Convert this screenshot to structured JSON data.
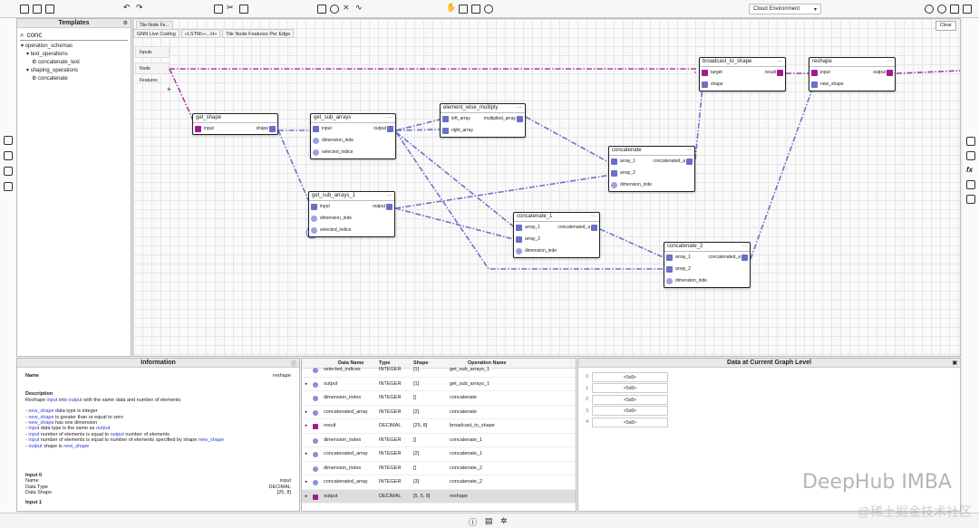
{
  "toolbar": {
    "environment": "Cloud Environment"
  },
  "templates": {
    "title": "Templates",
    "search_value": "conc",
    "tree": [
      {
        "label": "operation_schemas",
        "level": 0
      },
      {
        "label": "text_operations",
        "level": 1
      },
      {
        "label": "concatenate_text",
        "level": 2
      },
      {
        "label": "shaping_operations",
        "level": 1
      },
      {
        "label": "concatenate",
        "level": 2
      }
    ]
  },
  "canvas": {
    "tab_top": "Tile Node Fe...",
    "tabs": [
      "GNN Live Coding",
      "«LSTM»«...H»",
      "Tile Node Features Per Edge"
    ],
    "clear": "Clear",
    "ports": [
      "Inputs",
      "Node Features"
    ]
  },
  "nodes": {
    "get_shape": {
      "title": "get_shape",
      "in": "input",
      "out": "shape"
    },
    "get_sub_arrays": {
      "title": "get_sub_arrays",
      "rows": [
        "input",
        "dimension_inde",
        "selected_indice"
      ],
      "out": "output"
    },
    "element_wise_multiply": {
      "title": "element_wise_multiply",
      "rows": [
        "left_array",
        "right_array"
      ],
      "out": "multiplied_array"
    },
    "get_sub_arrays_1": {
      "title": "get_sub_arrays_1",
      "rows": [
        "input",
        "dimension_inde",
        "selected_indice"
      ],
      "out": "output"
    },
    "concatenate": {
      "title": "concatenate",
      "rows": [
        "array_1",
        "array_2",
        "dimension_inde"
      ],
      "out": "concatenated_a"
    },
    "concatenate_1": {
      "title": "concatenate_1",
      "rows": [
        "array_1",
        "array_2",
        "dimension_inde"
      ],
      "out": "concatenated_a"
    },
    "concatenate_2": {
      "title": "concatenate_2",
      "rows": [
        "array_1",
        "array_2",
        "dimension_inde"
      ],
      "out": "concatenated_a"
    },
    "broadcast_to_shape": {
      "title": "broadcast_to_shape",
      "rows": [
        "target",
        "shape"
      ],
      "out": "result"
    },
    "reshape": {
      "title": "reshape",
      "rows": [
        "input",
        "new_shape"
      ],
      "out": "output"
    }
  },
  "info": {
    "title": "Information",
    "name_label": "Name",
    "name_value": "reshape",
    "desc_label": "Description",
    "desc_pre": "Reshape ",
    "desc_in": "input",
    "desc_mid": " into ",
    "desc_out": "output",
    "desc_post": " with the same data and number of elements",
    "bullets": [
      {
        "a": "new_shape",
        "b": " data type is integer"
      },
      {
        "a": "new_shape",
        "b": " is greater than or equal to zero"
      },
      {
        "a": "new_shape",
        "b": " has one dimension"
      },
      {
        "a": "input",
        "b": " data type is the same as ",
        "c": "output"
      },
      {
        "a": "input",
        "b": " number of elements is equal to ",
        "c": "output",
        "d": " number of elements"
      },
      {
        "a": "input",
        "b": " number of elements is equal to number of elements specified by shape ",
        "c": "new_shape"
      },
      {
        "a": "output",
        "b": " shape is ",
        "c": "new_shape"
      }
    ],
    "input0": {
      "title": "Input 0",
      "rows": [
        [
          "Name",
          "input"
        ],
        [
          "Data Type",
          "DECIMAL"
        ],
        [
          "Data Shape",
          "[25, 8]"
        ]
      ]
    },
    "input1": {
      "title": "Input 1"
    }
  },
  "table": {
    "headers": [
      "Data Name",
      "Type",
      "Shape",
      "Operation Name"
    ],
    "rows": [
      {
        "name": "selected_indices",
        "type": "INTEGER",
        "shape": "[1]",
        "op": "get_sub_arrays_1",
        "exp": "",
        "dot": "c"
      },
      {
        "name": "output",
        "type": "INTEGER",
        "shape": "[1]",
        "op": "get_sub_arrays_1",
        "exp": "▸",
        "dot": "c"
      },
      {
        "name": "dimension_index",
        "type": "INTEGER",
        "shape": "[]",
        "op": "concatenate",
        "exp": "",
        "dot": "c"
      },
      {
        "name": "concatenated_array",
        "type": "INTEGER",
        "shape": "[2]",
        "op": "concatenate",
        "exp": "▸",
        "dot": "c"
      },
      {
        "name": "result",
        "type": "DECIMAL",
        "shape": "[25, 8]",
        "op": "broadcast_to_shape",
        "exp": "▸",
        "dot": "m"
      },
      {
        "name": "dimension_index",
        "type": "INTEGER",
        "shape": "[]",
        "op": "concatenate_1",
        "exp": "",
        "dot": "c"
      },
      {
        "name": "concatenated_array",
        "type": "INTEGER",
        "shape": "[2]",
        "op": "concatenate_1",
        "exp": "▸",
        "dot": "c"
      },
      {
        "name": "dimension_index",
        "type": "INTEGER",
        "shape": "[]",
        "op": "concatenate_2",
        "exp": "",
        "dot": "c"
      },
      {
        "name": "concatenated_array",
        "type": "INTEGER",
        "shape": "[3]",
        "op": "concatenate_2",
        "exp": "▸",
        "dot": "c"
      },
      {
        "name": "output",
        "type": "DECIMAL",
        "shape": "[5, 5, 8]",
        "op": "reshape",
        "exp": "▸",
        "dot": "m",
        "sel": true
      }
    ]
  },
  "data_panel": {
    "title": "Data at Current Graph Level",
    "rows": [
      {
        "i": "0",
        "v": "<5x8>"
      },
      {
        "i": "1",
        "v": "<5x8>"
      },
      {
        "i": "2",
        "v": "<5x8>"
      },
      {
        "i": "3",
        "v": "<5x8>"
      },
      {
        "i": "4",
        "v": "<5x8>"
      }
    ]
  },
  "watermark": {
    "brand": "DeepHub IMBA",
    "sub": "@稀土掘金技术社区"
  },
  "colors": {
    "edge": "#6e72c9",
    "edge_magenta": "#b03aa4",
    "port": "#6a6fc8",
    "port_magenta": "#a01c8e"
  }
}
